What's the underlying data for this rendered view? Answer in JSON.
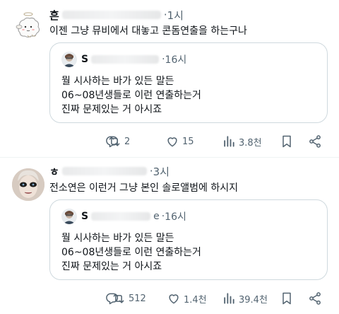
{
  "posts": [
    {
      "name": "흔",
      "time": "1시",
      "text": "이젠 그냥 뮤비에서 대놓고 콘돔연출을 하는구나",
      "quote": {
        "name": "S",
        "time": "16시",
        "lines": [
          "뭘 시사하는 바가 있든 말든",
          "06~08년생들로 이런 연출하는거",
          "진짜 문제있는 거 아시죠"
        ]
      },
      "stats": {
        "replies": "",
        "reposts": "2",
        "likes": "15",
        "views": "3.8천"
      }
    },
    {
      "name": "ㅎ",
      "time": "3시",
      "text": "전소연은 이런거 그냥 본인 솔로앨범에 하시지",
      "quote": {
        "name": "S",
        "handle": "e",
        "time": "16시",
        "lines": [
          "뭘 시사하는 바가 있든 말든",
          "06~08년생들로 이런 연출하는거",
          "진짜 문제있는 거 아시죠"
        ]
      },
      "stats": {
        "replies": "",
        "reposts": "512",
        "likes": "1.4천",
        "views": "39.4천"
      }
    }
  ],
  "colors": {
    "text": "#0f1419",
    "muted": "#536471",
    "border": "#cfd9de",
    "divider": "#eff3f4"
  },
  "icons": [
    "reply-icon",
    "repost-icon",
    "like-icon",
    "views-icon",
    "bookmark-icon",
    "share-icon"
  ]
}
